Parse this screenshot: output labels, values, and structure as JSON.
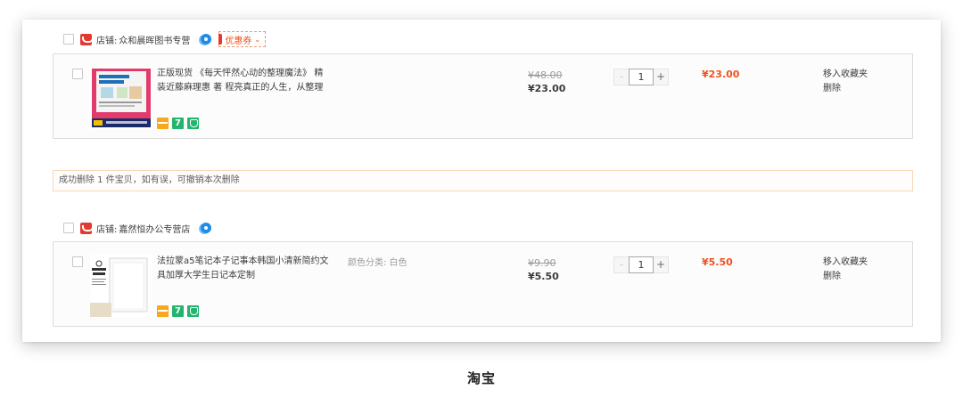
{
  "shops": [
    {
      "label": "店铺:",
      "name": "众和晨晖图书专营",
      "coupon": "优惠券",
      "item": {
        "title": "正版现货 《每天怦然心动的整理魔法》 精装近藤麻理惠 著 程亮真正的人生，从整理",
        "sku": "",
        "old_price": "¥48.00",
        "price": "¥23.00",
        "quantity": "1",
        "subtotal": "¥23.00",
        "actions": [
          "移入收藏夹",
          "删除"
        ]
      }
    },
    {
      "label": "店铺:",
      "name": "嘉然恒办公专营店",
      "item": {
        "title": "法拉蒙a5笔记本子记事本韩国小清新简约文具加厚大学生日记本定制",
        "sku": "颜色分类: 白色",
        "old_price": "¥9.90",
        "price": "¥5.50",
        "quantity": "1",
        "subtotal": "¥5.50",
        "actions": [
          "移入收藏夹",
          "删除"
        ]
      }
    }
  ],
  "notice": "成功删除 1 件宝贝，如有误，可撤销本次删除",
  "caption": "淘宝",
  "quantity_controls": {
    "minus": "-",
    "plus": "+"
  },
  "colors": {
    "accent": "#f0521e",
    "brand_red": "#e4392f",
    "badge_green": "#23b46e"
  },
  "icons": [
    "tmall-shop-icon",
    "wangwang-chat-icon",
    "card-payment-icon",
    "seven-day-return-icon",
    "guarantee-shield-icon"
  ]
}
